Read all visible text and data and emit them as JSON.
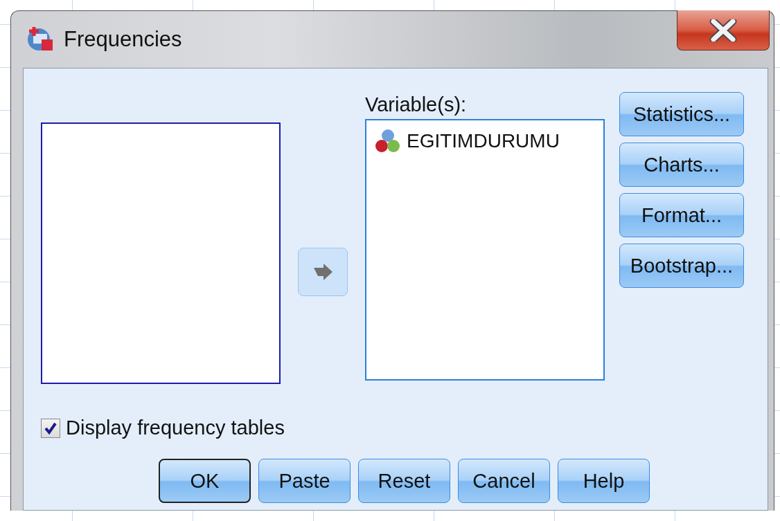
{
  "window": {
    "title": "Frequencies"
  },
  "move_button": {
    "disabled": true
  },
  "variables": {
    "label": "Variable(s):",
    "items": [
      {
        "name": "EGITIMDURUMU"
      }
    ]
  },
  "side_buttons": [
    "Statistics...",
    "Charts...",
    "Format...",
    "Bootstrap..."
  ],
  "display_tables": {
    "label": "Display frequency tables",
    "checked": true
  },
  "buttons": [
    {
      "label": "OK",
      "default": true
    },
    {
      "label": "Paste",
      "default": false
    },
    {
      "label": "Reset",
      "default": false
    },
    {
      "label": "Cancel",
      "default": false
    },
    {
      "label": "Help",
      "default": false
    }
  ]
}
